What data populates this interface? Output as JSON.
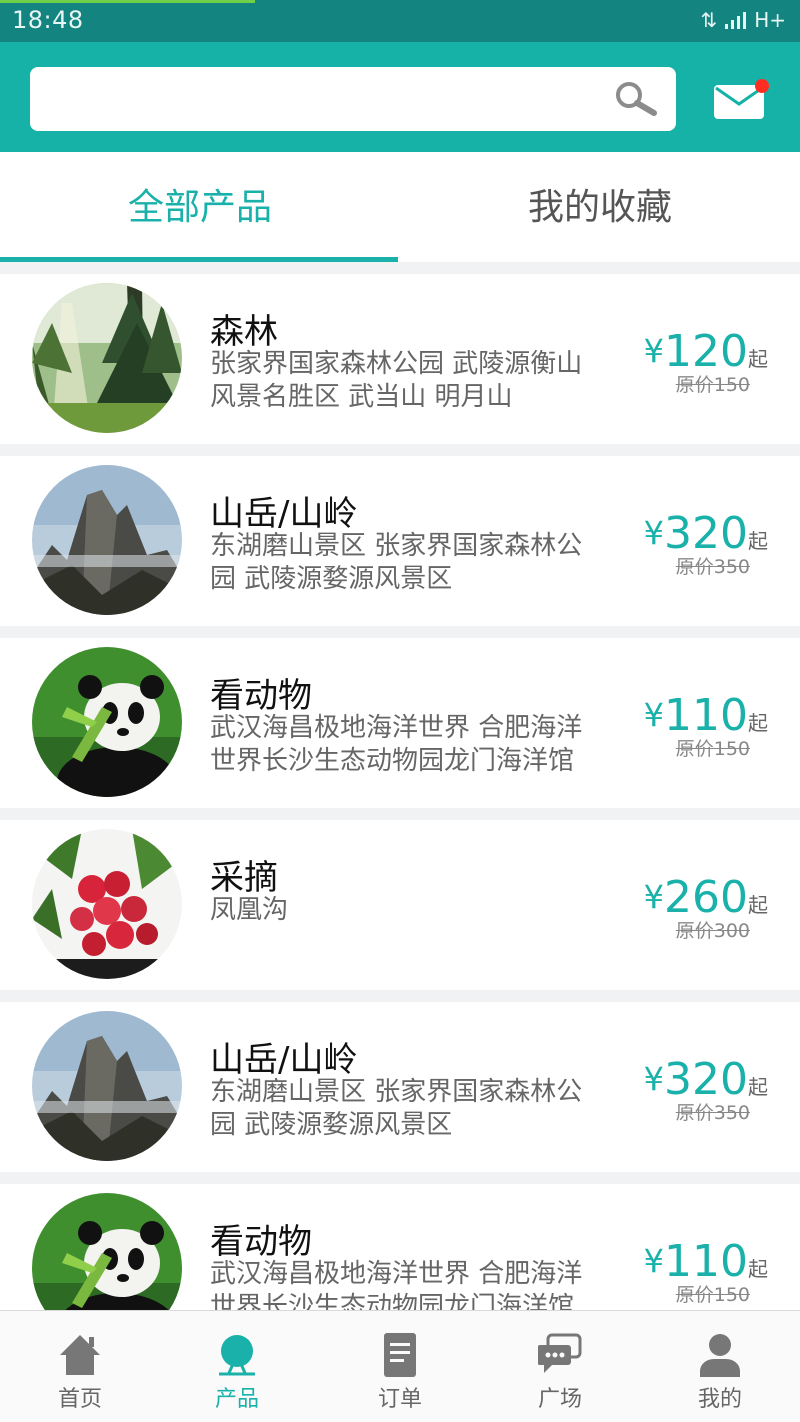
{
  "status_bar": {
    "time": "18:48",
    "network": "H+"
  },
  "search": {
    "value": "",
    "placeholder": ""
  },
  "tabs": [
    {
      "label": "全部产品",
      "active": true
    },
    {
      "label": "我的收藏",
      "active": false
    }
  ],
  "products": [
    {
      "title": "森林",
      "desc": "张家界国家森林公园 武陵源衡山风景名胜区  武当山 明月山",
      "currency": "¥",
      "price": "120",
      "suffix": "起",
      "original": "原价150",
      "image": "forest"
    },
    {
      "title": "山岳/山岭",
      "desc": "东湖磨山景区 张家界国家森林公园 武陵源婺源风景区",
      "currency": "¥",
      "price": "320",
      "suffix": "起",
      "original": "原价350",
      "image": "mountain"
    },
    {
      "title": "看动物",
      "desc": "武汉海昌极地海洋世界 合肥海洋世界长沙生态动物园龙门海洋馆",
      "currency": "¥",
      "price": "110",
      "suffix": "起",
      "original": "原价150",
      "image": "panda"
    },
    {
      "title": "采摘",
      "desc": "凤凰沟",
      "currency": "¥",
      "price": "260",
      "suffix": "起",
      "original": "原价300",
      "image": "lychee"
    },
    {
      "title": "山岳/山岭",
      "desc": "东湖磨山景区 张家界国家森林公园 武陵源婺源风景区",
      "currency": "¥",
      "price": "320",
      "suffix": "起",
      "original": "原价350",
      "image": "mountain"
    },
    {
      "title": "看动物",
      "desc": "武汉海昌极地海洋世界 合肥海洋世界长沙生态动物园龙门海洋馆",
      "currency": "¥",
      "price": "110",
      "suffix": "起",
      "original": "原价150",
      "image": "panda"
    }
  ],
  "nav": [
    {
      "label": "首页",
      "icon": "home-icon",
      "active": false
    },
    {
      "label": "产品",
      "icon": "product-icon",
      "active": true
    },
    {
      "label": "订单",
      "icon": "order-icon",
      "active": false
    },
    {
      "label": "广场",
      "icon": "chat-icon",
      "active": false
    },
    {
      "label": "我的",
      "icon": "user-icon",
      "active": false
    }
  ],
  "colors": {
    "accent": "#19b1a9",
    "header": "#16b2a8",
    "statusbar": "#13847f",
    "badge": "#ff2d22"
  }
}
